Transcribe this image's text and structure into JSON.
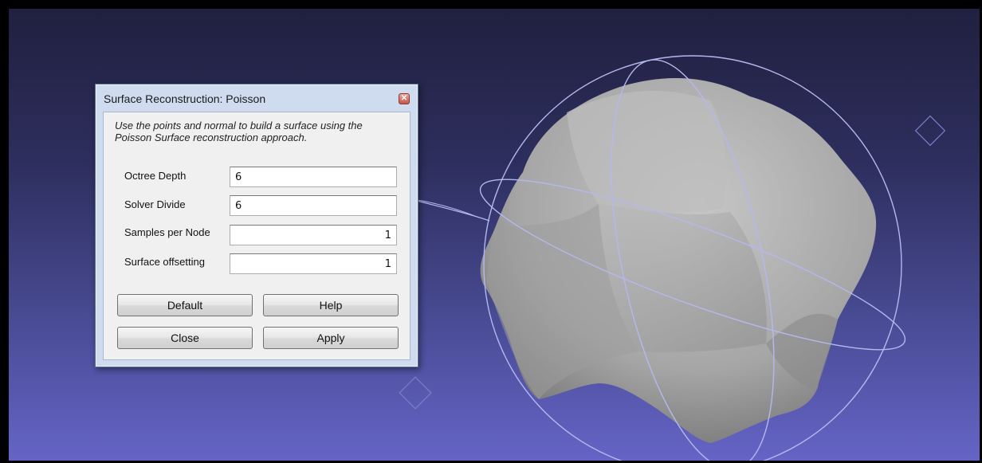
{
  "dialog": {
    "title": "Surface Reconstruction: Poisson",
    "description": "Use the points and normal to build a surface using the Poisson Surface reconstruction approach.",
    "fields": [
      {
        "label": "Octree Depth",
        "value": "6"
      },
      {
        "label": "Solver Divide",
        "value": "6"
      },
      {
        "label": "Samples per Node",
        "value": "1"
      },
      {
        "label": "Surface offsetting",
        "value": "1"
      }
    ],
    "buttons": {
      "default": "Default",
      "help": "Help",
      "close": "Close",
      "apply": "Apply"
    }
  },
  "colors": {
    "background_top": "#20203f",
    "background_bottom": "#6564c6",
    "mesh": "#a3a3a3",
    "trackball": "#aab0e8"
  },
  "icons": {
    "close": "close-icon"
  }
}
